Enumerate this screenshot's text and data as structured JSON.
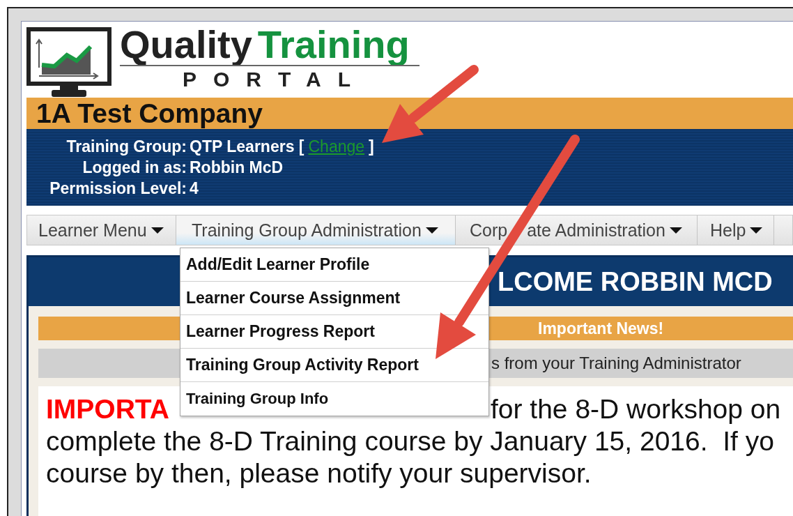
{
  "logo": {
    "word_1": "Quality",
    "word_2": "Training",
    "subtitle": "PORTAL"
  },
  "company": "1A Test Company",
  "account_info": [
    {
      "label": "Training Group:",
      "value": "QTP Learners [",
      "link": "Change",
      "after": "]"
    },
    {
      "label": "Logged in as:",
      "value": "Robbin McD"
    },
    {
      "label": "Permission Level:",
      "value": "4"
    }
  ],
  "nav": [
    {
      "parts": [
        "Learner Menu"
      ],
      "selected": false
    },
    {
      "parts": [
        "Training Group Administration"
      ],
      "selected": true
    },
    {
      "parts": [
        "Corp",
        "ate Administration"
      ],
      "selected": false
    },
    {
      "parts": [
        "Help"
      ],
      "selected": false
    }
  ],
  "dropdown": [
    {
      "label": "Add/Edit Learner Profile",
      "selected": false
    },
    {
      "label": "Learner Course Assignment",
      "selected": false
    },
    {
      "label": "Learner Progress Report",
      "selected": false
    },
    {
      "label": "Training Group Activity Report",
      "selected": false
    },
    {
      "label": "Training Group Info",
      "selected": false
    }
  ],
  "welcome": "LCOME ROBBIN MCD",
  "news": {
    "title": "Important News!",
    "subtitle": "s from your Training Administrator"
  },
  "message": [
    [
      {
        "kind": "alert",
        "text": "IMPORTA"
      },
      {
        "kind": "plain",
        "text": "for the 8-D workshop on"
      }
    ],
    [
      {
        "kind": "plain",
        "text": "complete the 8-D Training course by January 15, 2016.  If yo"
      }
    ],
    [
      {
        "kind": "plain",
        "text": "course by then, please notify your supervisor."
      }
    ]
  ]
}
